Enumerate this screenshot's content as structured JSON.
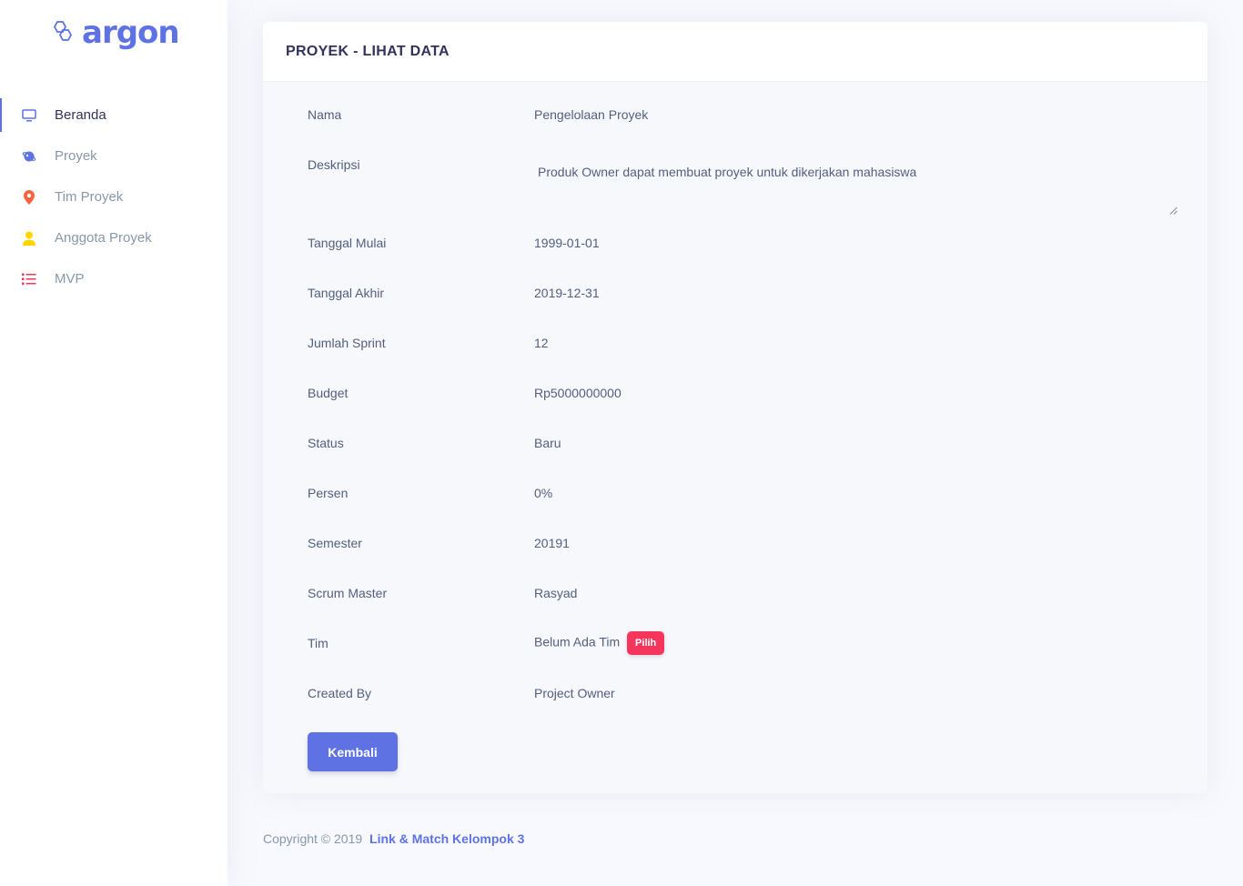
{
  "brand": {
    "name": "argon"
  },
  "sidebar": {
    "items": [
      {
        "label": "Beranda",
        "icon": "monitor-icon",
        "color": "#5e72e4",
        "active": true
      },
      {
        "label": "Proyek",
        "icon": "planet-icon",
        "color": "#5e72e4",
        "active": false
      },
      {
        "label": "Tim Proyek",
        "icon": "pin-icon",
        "color": "#fb6340",
        "active": false
      },
      {
        "label": "Anggota Proyek",
        "icon": "user-icon",
        "color": "#ffd600",
        "active": false
      },
      {
        "label": "MVP",
        "icon": "list-icon",
        "color": "#f5365c",
        "active": false
      }
    ]
  },
  "card": {
    "title": "PROYEK - LIHAT DATA",
    "fields": {
      "nama": {
        "label": "Nama",
        "value": "Pengelolaan Proyek"
      },
      "deskripsi": {
        "label": "Deskripsi",
        "value": "Produk Owner dapat membuat proyek untuk dikerjakan mahasiswa"
      },
      "tanggal_mulai": {
        "label": "Tanggal Mulai",
        "value": "1999-01-01"
      },
      "tanggal_akhir": {
        "label": "Tanggal Akhir",
        "value": "2019-12-31"
      },
      "jumlah_sprint": {
        "label": "Jumlah Sprint",
        "value": "12"
      },
      "budget": {
        "label": "Budget",
        "value": "Rp5000000000"
      },
      "status": {
        "label": "Status",
        "value": "Baru"
      },
      "persen": {
        "label": "Persen",
        "value": "0%"
      },
      "semester": {
        "label": "Semester",
        "value": "20191"
      },
      "scrum_master": {
        "label": "Scrum Master",
        "value": "Rasyad"
      },
      "tim": {
        "label": "Tim",
        "value": "Belum Ada Tim",
        "button": "Pilih"
      },
      "created_by": {
        "label": "Created By",
        "value": "Project Owner"
      }
    },
    "back_button": "Kembali"
  },
  "footer": {
    "copyright": "Copyright © 2019",
    "link": "Link & Match Kelompok 3"
  },
  "colors": {
    "primary": "#5e72e4",
    "danger": "#f5365c",
    "warning": "#fb6340",
    "yellow": "#ffd600"
  }
}
